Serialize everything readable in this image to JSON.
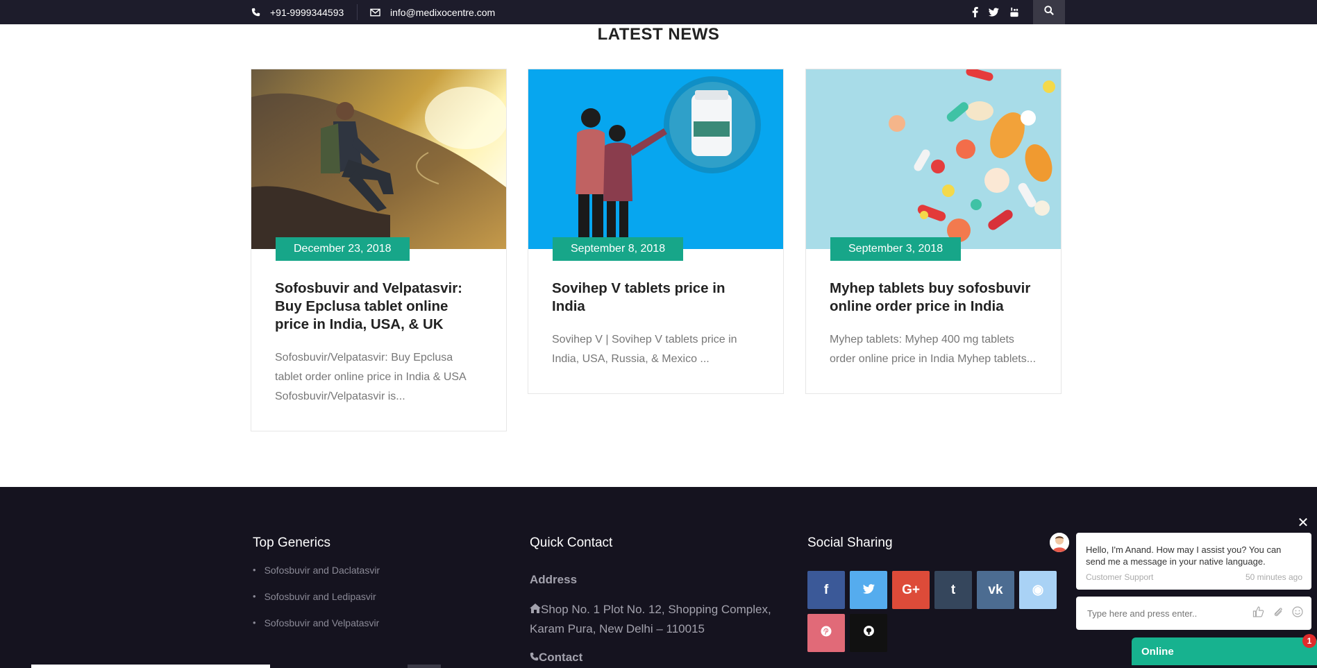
{
  "topbar": {
    "phone": "+91-9999344593",
    "email": "info@medixocentre.com",
    "social_icons": [
      "facebook-icon",
      "twitter-icon",
      "youtube-icon"
    ],
    "search_icon": "search-icon"
  },
  "news": {
    "title": "LATEST NEWS",
    "cards": [
      {
        "date": "December 23, 2018",
        "title": "Sofosbuvir and Velpatasvir: Buy Epclusa tablet online price in India, USA, & UK",
        "excerpt": "Sofosbuvir/Velpatasvir: Buy Epclusa tablet order online price in India & USA Sofosbuvir/Velpatasvir is..."
      },
      {
        "date": "September 8, 2018",
        "title": "Sovihep V tablets price in India",
        "excerpt": "Sovihep V | Sovihep V tablets price in India, USA, Russia, & Mexico ..."
      },
      {
        "date": "September 3, 2018",
        "title": "Myhep tablets buy sofosbuvir online order price in India",
        "excerpt": "Myhep tablets: Myhep 400 mg tablets order online price in India Myhep tablets..."
      }
    ]
  },
  "footer": {
    "top_generics": {
      "heading": "Top Generics",
      "items": [
        "Sofosbuvir and Daclatasvir",
        "Sofosbuvir and Ledipasvir",
        "Sofosbuvir and Velpatasvir"
      ]
    },
    "quick_contact": {
      "heading": "Quick Contact",
      "address_label": "Address",
      "address": "Shop No. 1 Plot No. 12, Shopping Complex, Karam Pura, New Delhi – 110015",
      "contact_label": "Contact"
    },
    "social": {
      "heading": "Social Sharing",
      "buttons": [
        {
          "name": "facebook",
          "glyph": "f",
          "color": "#3b5998"
        },
        {
          "name": "twitter",
          "glyph": "t",
          "color": "#55acee"
        },
        {
          "name": "google-plus",
          "glyph": "G+",
          "color": "#dd4b39"
        },
        {
          "name": "tumblr",
          "glyph": "t",
          "color": "#35465c"
        },
        {
          "name": "vk",
          "glyph": "vk",
          "color": "#4c6c91"
        },
        {
          "name": "reddit",
          "glyph": "◉",
          "color": "#a9d2f5"
        },
        {
          "name": "pinterest",
          "glyph": "P",
          "color": "#e16a78"
        },
        {
          "name": "github",
          "glyph": "◐",
          "color": "#111111"
        }
      ]
    }
  },
  "chat": {
    "message": "Hello, I'm Anand. How may I assist you? You can send me a message in your native language.",
    "sender": "Customer Support",
    "time": "50 minutes ago",
    "input_placeholder": "Type here and press enter..",
    "status": "Online",
    "badge": "1"
  }
}
